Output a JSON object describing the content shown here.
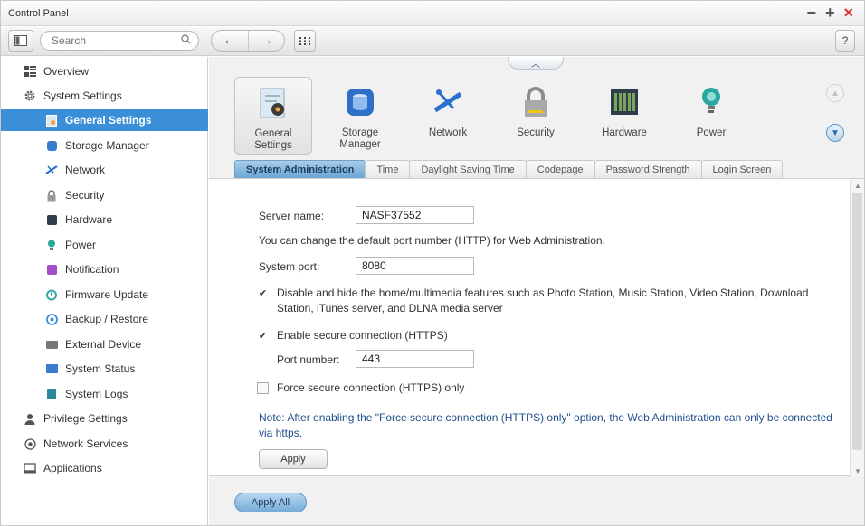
{
  "window": {
    "title": "Control Panel"
  },
  "toolbar": {
    "search_placeholder": "Search",
    "help_label": "?"
  },
  "sidebar": {
    "items": [
      {
        "label": "Overview",
        "level": "top"
      },
      {
        "label": "System Settings",
        "level": "top"
      },
      {
        "label": "General Settings",
        "level": "sub",
        "active": true
      },
      {
        "label": "Storage Manager",
        "level": "sub"
      },
      {
        "label": "Network",
        "level": "sub"
      },
      {
        "label": "Security",
        "level": "sub"
      },
      {
        "label": "Hardware",
        "level": "sub"
      },
      {
        "label": "Power",
        "level": "sub"
      },
      {
        "label": "Notification",
        "level": "sub"
      },
      {
        "label": "Firmware Update",
        "level": "sub"
      },
      {
        "label": "Backup / Restore",
        "level": "sub"
      },
      {
        "label": "External Device",
        "level": "sub"
      },
      {
        "label": "System Status",
        "level": "sub"
      },
      {
        "label": "System Logs",
        "level": "sub"
      },
      {
        "label": "Privilege Settings",
        "level": "top"
      },
      {
        "label": "Network Services",
        "level": "top"
      },
      {
        "label": "Applications",
        "level": "top"
      }
    ]
  },
  "apps": [
    {
      "label": "General Settings",
      "icon": "general-settings-icon"
    },
    {
      "label": "Storage Manager",
      "icon": "storage-manager-icon"
    },
    {
      "label": "Network",
      "icon": "network-icon"
    },
    {
      "label": "Security",
      "icon": "security-lock-icon"
    },
    {
      "label": "Hardware",
      "icon": "hardware-icon"
    },
    {
      "label": "Power",
      "icon": "power-bulb-icon"
    }
  ],
  "tabs": [
    "System Administration",
    "Time",
    "Daylight Saving Time",
    "Codepage",
    "Password Strength",
    "Login Screen"
  ],
  "form": {
    "server_name_label": "Server name:",
    "server_name_value": "NASF37552",
    "port_hint": "You can change the default port number (HTTP) for Web Administration.",
    "system_port_label": "System port:",
    "system_port_value": "8080",
    "disable_multimedia_line1": "Disable and hide the home/multimedia features such as Photo Station, Music Station, Video Station, Download",
    "disable_multimedia_line2": "Station, iTunes server, and DLNA media server",
    "enable_https_label": "Enable secure connection (HTTPS)",
    "port_number_label": "Port number:",
    "port_number_value": "443",
    "force_https_label": "Force secure connection (HTTPS) only",
    "note_line1": "Note: After enabling the \"Force secure connection (HTTPS) only\" option, the Web Administration can only be connected",
    "note_line2": "via https.",
    "apply_label": "Apply"
  },
  "footer": {
    "apply_all_label": "Apply All"
  },
  "colors": {
    "accent": "#3b8fd8",
    "close": "#d9302c",
    "note": "#1f4f8c"
  }
}
